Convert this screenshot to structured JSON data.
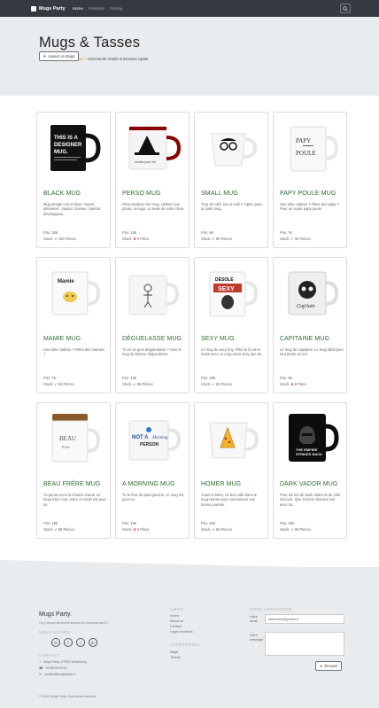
{
  "nav": {
    "brand": "Mugs Party",
    "links": [
      "Home",
      "Features",
      "Pricing"
    ]
  },
  "hero": {
    "title": "Mugs & Tasses",
    "subtitle_accent": "Une tasse d'une délicieuse",
    "subtitle_rest": "Commande simple et livraison rapide",
    "add_button": "Ajouter un Mugs"
  },
  "labels": {
    "price_prefix": "Prix:",
    "stock_prefix": "Stock:"
  },
  "products": [
    {
      "title": "BLACK MUG",
      "desc": "Mug design noir et blanc Yoann, utilisation : maison, bureau. Spécial développeur",
      "price": "30€",
      "stock": "100 Pièces",
      "in_stock": true,
      "image": "black-mug"
    },
    {
      "title": "PERSO MUG",
      "desc": "Personnalisez ton mug. Utilisez une photo, un logo, un texte de votre choix",
      "price": "12€",
      "stock": "0 Pièce",
      "in_stock": false,
      "image": "perso-mug"
    },
    {
      "title": "SMALL MUG",
      "desc": "Trop de café, tue le café !! Optez pour un petit mug.",
      "price": "8€",
      "stock": "80 Pièces",
      "in_stock": true,
      "image": "small-mug"
    },
    {
      "title": "PAPY POULE MUG",
      "desc": "Une idée cadeau ? Fêtez des papy ? Pour un super papy poule.",
      "price": "7€",
      "stock": "50 Pièces",
      "in_stock": true,
      "image": "papy-mug"
    },
    {
      "title": "MAMIE MUG",
      "desc": "Une idée cadeau ? Fêtes des mamies ?",
      "price": "7€",
      "stock": "60 Pièces",
      "in_stock": true,
      "image": "mamie-mug"
    },
    {
      "title": "DÉGUELASSE MUG",
      "desc": "Tu es un gros dégueulasse ? Voici le mug du baveur dégueulasse",
      "price": "13€",
      "stock": "98 Pièces",
      "in_stock": true,
      "image": "deguelasse-mug"
    },
    {
      "title": "SEXY MUG",
      "desc": "Le mug du sexy boy. Fête toi la vie le matin avec ce mug aussi sexy que toi.",
      "price": "20€",
      "stock": "65 Pièces",
      "in_stock": true,
      "image": "sexy-mug"
    },
    {
      "title": "CAPITAINE MUG",
      "desc": "Le mug du capitaine. Le mug idéal pour tout pirate du net.",
      "price": "8€",
      "stock": "0 Pièce",
      "in_stock": false,
      "image": "capitaine-mug"
    },
    {
      "title": "BEAU FRÈRE MUG",
      "desc": "Tu pense avoir la chance d'avoir un beau frère cool. Alors ce MUG est pour toi.",
      "price": "15€",
      "stock": "88 Pièces",
      "in_stock": true,
      "image": "beau-frere-mug"
    },
    {
      "title": "A MORNING MUG",
      "desc": "Tu te lève du pied gauche, ce mug est pour toi",
      "price": "16€",
      "stock": "0 Pièce",
      "in_stock": false,
      "image": "morning-mug"
    },
    {
      "title": "HOMER MUG",
      "desc": "Avant le bière, un bon café dans le mug Homer pour commencer une bonne journée.",
      "price": "22€",
      "stock": "55 Pièces",
      "in_stock": true,
      "image": "homer-mug"
    },
    {
      "title": "DARK VADOR MUG",
      "desc": "Pour les fan de Dark Vador et du côté obscure. Que la force obscure soit avec toi.",
      "price": "30€",
      "stock": "99 Pièces",
      "in_stock": true,
      "image": "vador-mug"
    }
  ],
  "footer": {
    "brand": "Mugs Party.",
    "tagline": "On y trouve de tout et surtout du n'importe quoi !!",
    "follow_heading": "NOUS SUIVRE",
    "socials": [
      "G",
      "f",
      "t",
      "in"
    ],
    "contact_heading": "CONTACT",
    "address": "Mugs Party, 67000 Strasbourg",
    "phone": "03 88 00 00 00",
    "email": "contact@mugsparty.fr",
    "links_heading": "LIENS",
    "links": [
      "Home",
      "About us",
      "Contact",
      "Legal mentions"
    ],
    "categories_heading": "CATÉGORIES",
    "categories": [
      "Mugs",
      "Tasses"
    ],
    "form_heading": "NOUS CONTACTER",
    "email_label": "Votre email",
    "email_value": "username@yahoo.fr",
    "message_label": "Votre message",
    "send_button": "Envoyer",
    "copyright": "© 2021 Mugs Party. Tous droits réservés"
  }
}
